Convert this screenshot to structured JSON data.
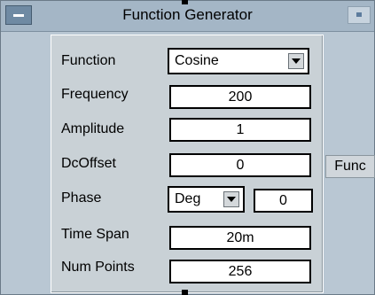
{
  "window": {
    "title": "Function Generator"
  },
  "fields": {
    "function": {
      "label": "Function",
      "value": "Cosine"
    },
    "frequency": {
      "label": "Frequency",
      "value": "200"
    },
    "amplitude": {
      "label": "Amplitude",
      "value": "1"
    },
    "dcoffset": {
      "label": "DcOffset",
      "value": "0"
    },
    "phase": {
      "label": "Phase",
      "unit": "Deg",
      "value": "0"
    },
    "timespan": {
      "label": "Time Span",
      "value": "20m"
    },
    "numpoints": {
      "label": "Num Points",
      "value": "256"
    }
  },
  "output_pin": {
    "label": "Func"
  },
  "colors": {
    "window_bg": "#b9c7d3",
    "panel_bg": "#c9d1d6",
    "titlebar": "#a4b6c6",
    "min_button": "#6f8aa3"
  }
}
